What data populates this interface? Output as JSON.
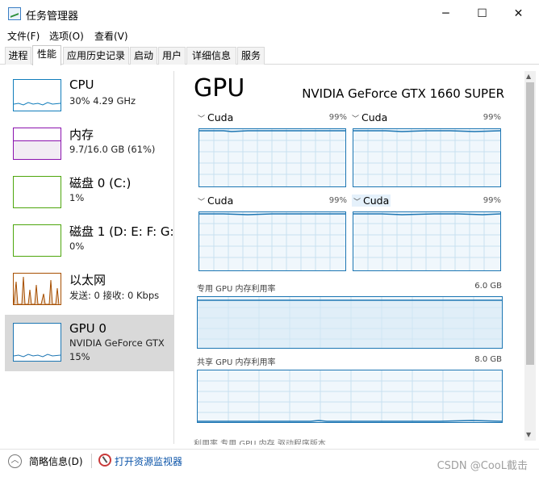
{
  "window": {
    "title": "任务管理器",
    "controls": {
      "minimize": "─",
      "maximize": "☐",
      "close": "✕"
    }
  },
  "menu": [
    "文件(F)",
    "选项(O)",
    "查看(V)"
  ],
  "tabs": [
    "进程",
    "性能",
    "应用历史记录",
    "启动",
    "用户",
    "详细信息",
    "服务"
  ],
  "resources": [
    {
      "name": "CPU",
      "detail": "30% 4.29 GHz",
      "color": "#117dbb"
    },
    {
      "name": "内存",
      "detail": "9.7/16.0 GB (61%)",
      "color": "#8b12ae"
    },
    {
      "name": "磁盘 0 (C:)",
      "detail": "1%",
      "color": "#4da60c"
    },
    {
      "name": "磁盘 1 (D: E: F: G:",
      "detail": "0%",
      "color": "#4da60c"
    },
    {
      "name": "以太网",
      "detail": "发送: 0 接收: 0 Kbps",
      "color": "#a74f01"
    },
    {
      "name": "GPU 0",
      "detail1": "NVIDIA GeForce GTX",
      "detail2": "15%",
      "color": "#1d76b3"
    }
  ],
  "main": {
    "title": "GPU",
    "model": "NVIDIA GeForce GTX 1660 SUPER",
    "engines": [
      {
        "label": "Cuda",
        "pct": "99%"
      },
      {
        "label": "Cuda",
        "pct": "99%"
      },
      {
        "label": "Cuda",
        "pct": "99%"
      },
      {
        "label": "Cuda",
        "pct": "99%"
      }
    ],
    "dedicated": {
      "label": "专用 GPU 内存利用率",
      "value": "6.0 GB"
    },
    "shared": {
      "label": "共享 GPU 内存利用率",
      "value": "8.0 GB"
    },
    "cut_text": "利用率                                   专用 GPU 内存                   驱动程序版本                                "
  },
  "footer": {
    "fewer_details": "简略信息(D)",
    "open_monitor": "打开资源监视器"
  },
  "watermark": "CSDN @CooL截击"
}
